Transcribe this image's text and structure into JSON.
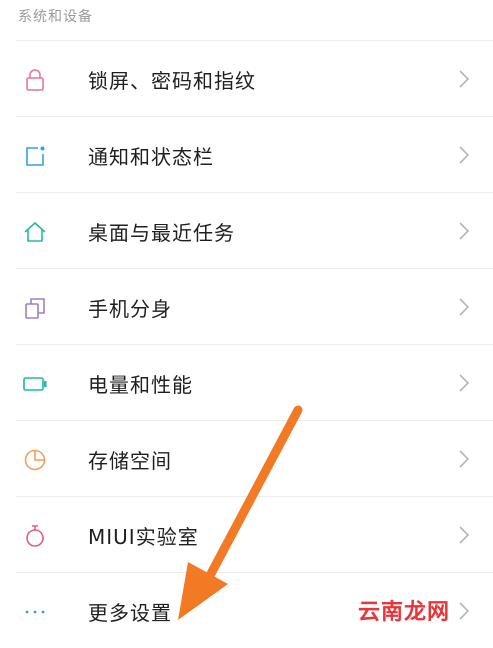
{
  "section_title": "系统和设备",
  "items": [
    {
      "label": "锁屏、密码和指纹",
      "icon": "lock-icon",
      "color": "#e7769a"
    },
    {
      "label": "通知和状态栏",
      "icon": "notification-icon",
      "color": "#2fa6e0"
    },
    {
      "label": "桌面与最近任务",
      "icon": "home-icon",
      "color": "#2fb7a0"
    },
    {
      "label": "手机分身",
      "icon": "dual-app-icon",
      "color": "#9b7fcf"
    },
    {
      "label": "电量和性能",
      "icon": "battery-icon",
      "color": "#23b7a4"
    },
    {
      "label": "存储空间",
      "icon": "storage-pie-icon",
      "color": "#f2a05a"
    },
    {
      "label": "MIUI实验室",
      "icon": "lab-flask-icon",
      "color": "#e05f88"
    },
    {
      "label": "更多设置",
      "icon": "more-dots-icon",
      "color": "#3aa0dc"
    }
  ],
  "annotation_arrow_color": "#f27a24",
  "watermark": "云南龙网"
}
